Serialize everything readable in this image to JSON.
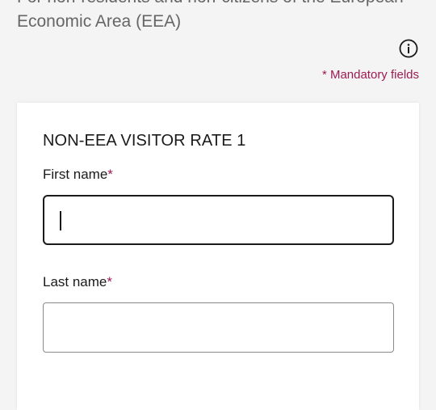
{
  "intro": {
    "text": "For non-residents and non-citizens of the European Economic Area (EEA)"
  },
  "info_icon": "info-circle-icon",
  "mandatory_note": "* Mandatory fields",
  "form": {
    "title": "NON-EEA VISITOR RATE 1",
    "first_name": {
      "label": "First name",
      "required_mark": "*",
      "value": ""
    },
    "last_name": {
      "label": "Last name",
      "required_mark": "*",
      "value": ""
    }
  },
  "colors": {
    "accent": "#9b1c53",
    "text": "#1a1a1a",
    "muted": "#666666",
    "background": "#f4f4f4",
    "card": "#ffffff"
  }
}
